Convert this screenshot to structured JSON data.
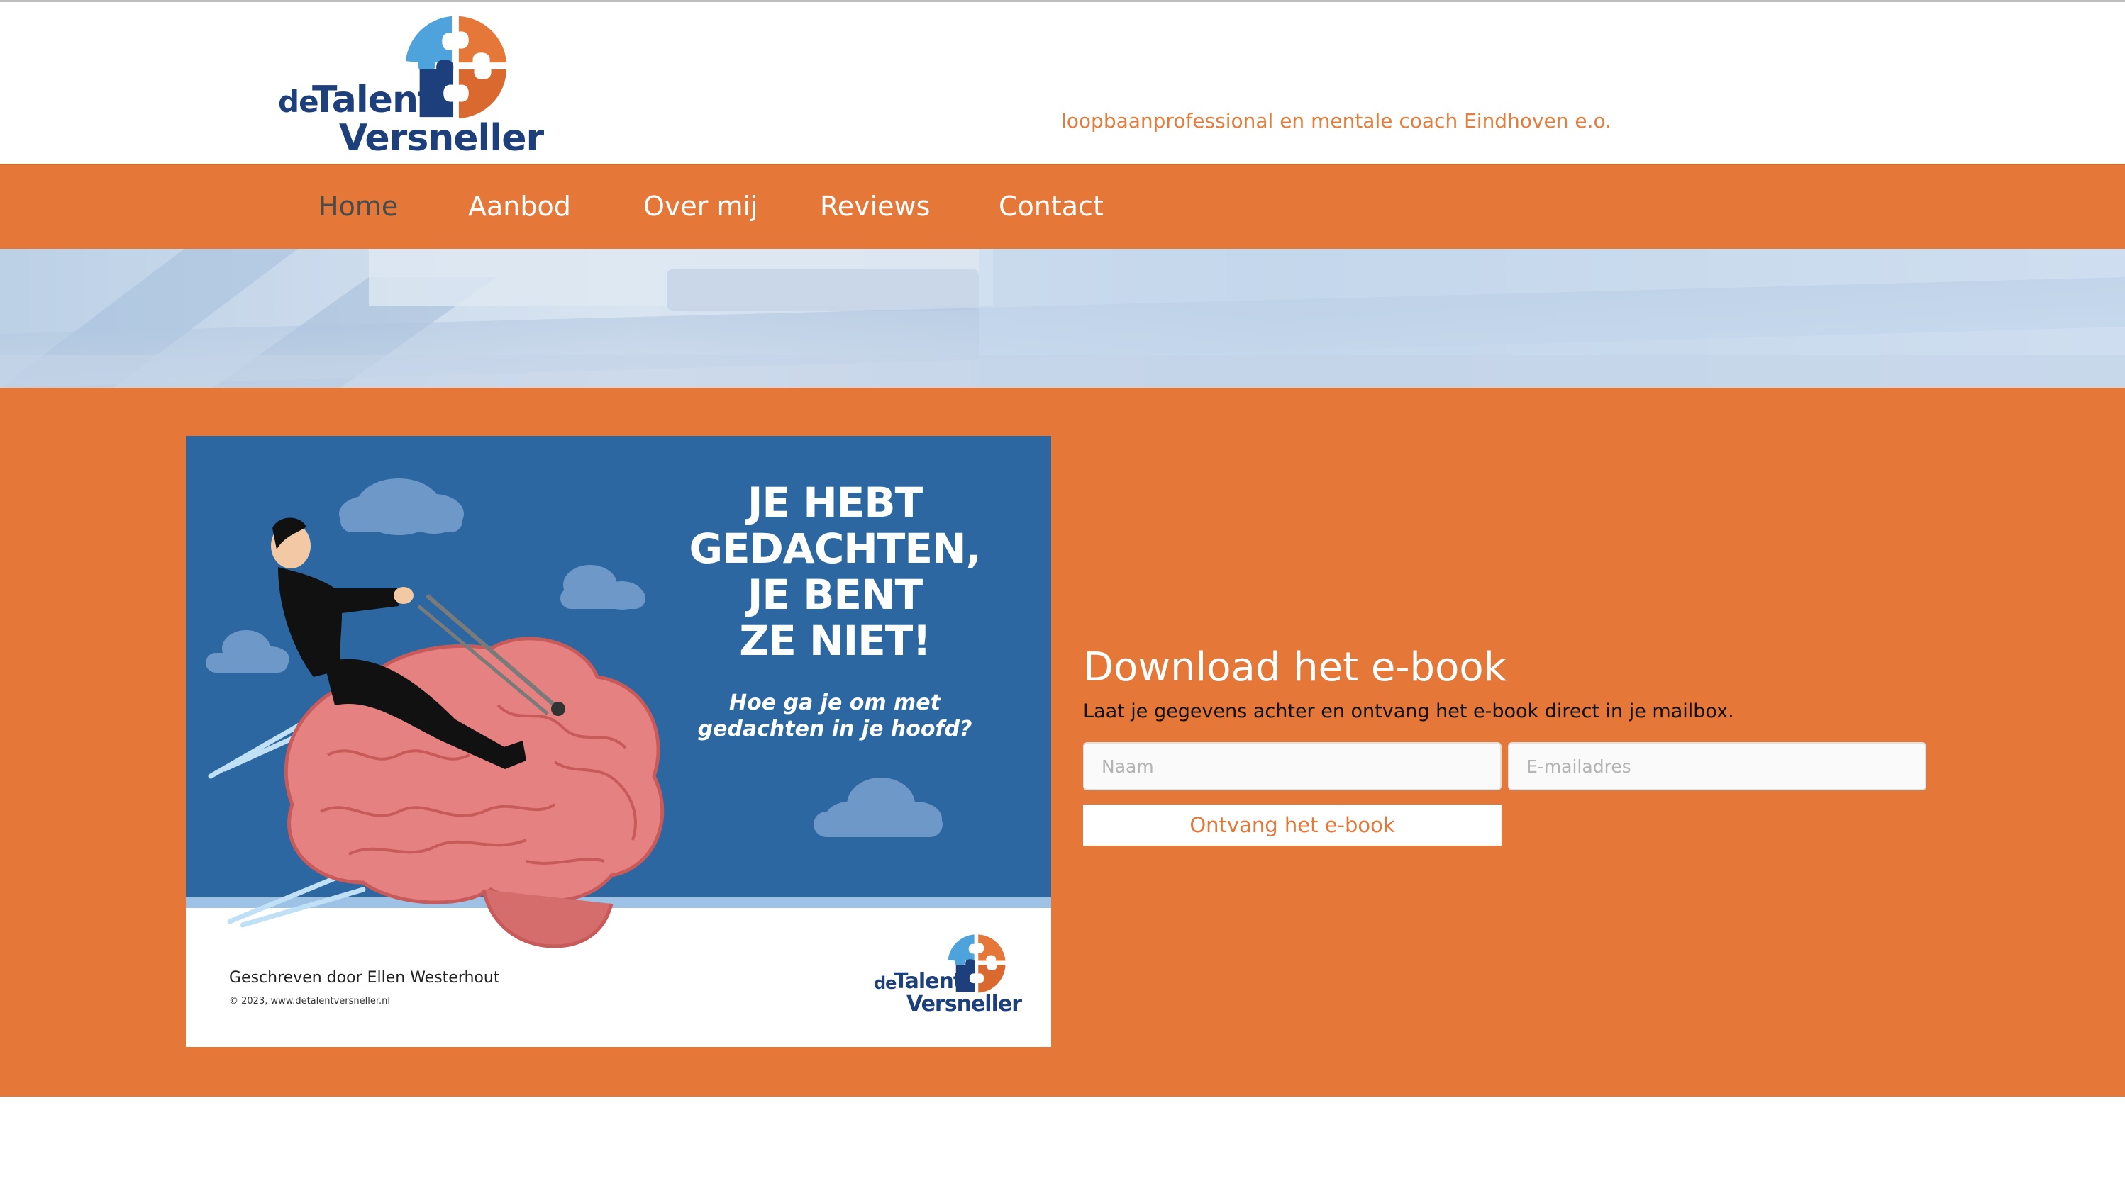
{
  "brand": {
    "logo_de": "de",
    "logo_talent": "Talent",
    "logo_versneller": "Versneller",
    "tagline": "loopbaanprofessional en mentale coach Eindhoven e.o."
  },
  "nav": {
    "items": [
      {
        "label": "Home",
        "active": true
      },
      {
        "label": "Aanbod"
      },
      {
        "label": "Over mij"
      },
      {
        "label": "Reviews"
      },
      {
        "label": "Contact"
      }
    ]
  },
  "ebook": {
    "headline_lines": [
      "JE HEBT",
      "GEDACHTEN,",
      "JE BENT",
      "ZE NIET!"
    ],
    "subtitle_lines": [
      "Hoe ga je om met",
      "gedachten in je hoofd?"
    ],
    "author": "Geschreven door Ellen Westerhout",
    "copyright": "© 2023, www.detalentversneller.nl"
  },
  "form": {
    "title": "Download het e-book",
    "intro": "Laat je gegevens achter en ontvang het e-book direct in je mailbox.",
    "name_placeholder": "Naam",
    "email_placeholder": "E-mailadres",
    "submit_label": "Ontvang het e-book"
  },
  "colors": {
    "orange": "#e57738",
    "navy": "#1d3f7c",
    "ebook_blue": "#2d67a1",
    "puzzle_light_blue": "#4fa3dd",
    "puzzle_orange": "#e57738"
  },
  "icons": [
    "puzzle-logo-icon",
    "cloud-icon",
    "brain-illustration",
    "businessman-illustration"
  ]
}
